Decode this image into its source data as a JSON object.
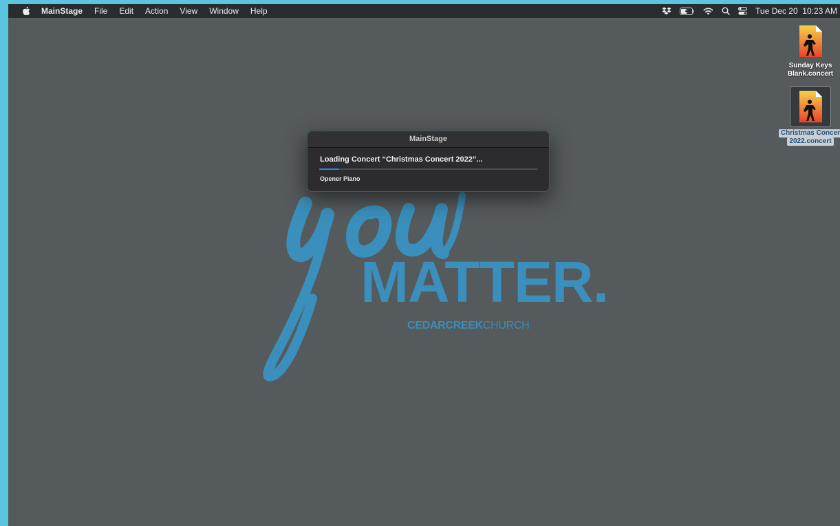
{
  "menubar": {
    "app_name": "MainStage",
    "menus": [
      "File",
      "Edit",
      "Action",
      "View",
      "Window",
      "Help"
    ],
    "clock": "Tue Dec 20  10:23 AM",
    "status_icons": [
      "dropbox-icon",
      "battery-icon",
      "wifi-icon",
      "search-icon",
      "control-center-icon"
    ]
  },
  "desktop": {
    "icons": [
      {
        "line1": "Sunday Keys",
        "line2": "Blank.concert"
      },
      {
        "line1": "Christmas Concer",
        "line2": "2022.concert"
      }
    ]
  },
  "wallpaper": {
    "script_word": "you",
    "headline": "MATTER.",
    "church_bold": "CEDARCREEK",
    "church_light": "CHURCH",
    "color": "#3a8fbc"
  },
  "dialog": {
    "title": "MainStage",
    "message": "Loading Concert “Christmas Concert 2022”...",
    "progress_percent": 9,
    "status": "Opener Piano"
  },
  "colors": {
    "desktop": "#555a5c",
    "menubar": "#2a2d2f",
    "accent": "#3b7ee6",
    "frame": "#5bc4de"
  }
}
